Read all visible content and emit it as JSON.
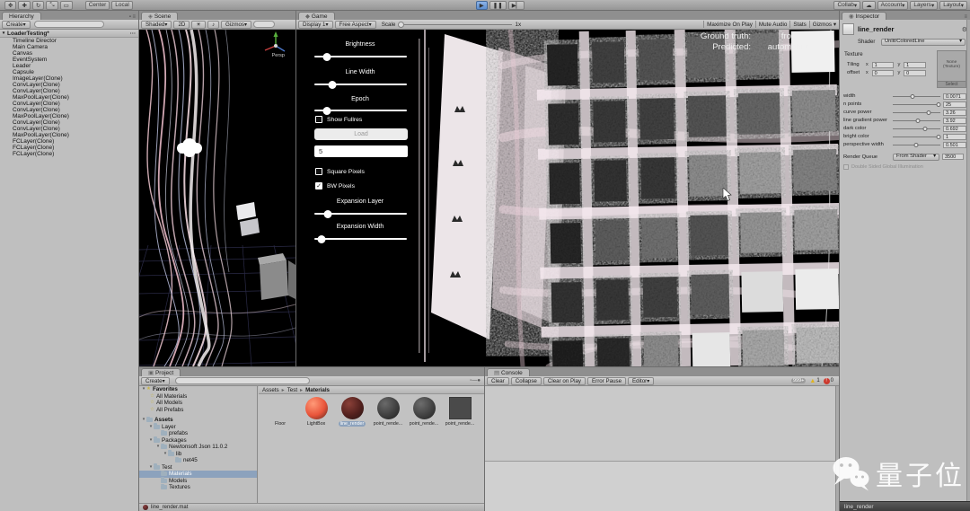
{
  "topbar": {
    "pivot": "Center",
    "space": "Local",
    "collab": "Collab",
    "account": "Account",
    "layers": "Layers",
    "layout": "Layout"
  },
  "hierarchy": {
    "tab": "Hierarchy",
    "create": "Create",
    "scene_name": "LoaderTesting*",
    "items": [
      "Timeline Director",
      "Main Camera",
      "Canvas",
      "EventSystem",
      "Leader",
      "Capsule",
      "ImageLayer(Clone)",
      "ConvLayer(Clone)",
      "ConvLayer(Clone)",
      "MaxPoolLayer(Clone)",
      "ConvLayer(Clone)",
      "ConvLayer(Clone)",
      "MaxPoolLayer(Clone)",
      "ConvLayer(Clone)",
      "ConvLayer(Clone)",
      "MaxPoolLayer(Clone)",
      "FCLayer(Clone)",
      "FCLayer(Clone)",
      "FCLayer(Clone)"
    ]
  },
  "scene": {
    "tab": "Scene",
    "shaded": "Shaded",
    "mode2d": "2D",
    "gizmos": "Gizmos",
    "persp": "Persp"
  },
  "game": {
    "tab": "Game",
    "display": "Display 1",
    "aspect": "Free Aspect",
    "scale_label": "Scale",
    "scale_value": "1x",
    "maximize": "Maximize On Play",
    "mute": "Mute Audio",
    "stats": "Stats",
    "gizmos": "Gizmos",
    "controls": {
      "brightness": "Brightness",
      "line_width": "Line Width",
      "epoch": "Epoch",
      "show_fullres": "Show Fullres",
      "load": "Load",
      "epoch_field": "5",
      "square_pixels": "Square Pixels",
      "bw_pixels": "BW Pixels",
      "expansion_layer": "Expansion Layer",
      "expansion_width": "Expansion Width",
      "slider_positions": {
        "brightness": "14%",
        "line_width": "19%",
        "epoch": "14%",
        "expansion_layer": "15%",
        "expansion_width": "8%"
      },
      "checkbox_states": {
        "show_fullres": false,
        "square_pixels": false,
        "bw_pixels": true
      }
    },
    "readout": {
      "gt_label": "Ground truth:",
      "gt_value": "frog",
      "pred_label": "Predicted:",
      "pred_value": "automobile"
    }
  },
  "inspector": {
    "tab": "Inspector",
    "material": "line_render",
    "shader_label": "Shader",
    "shader": "Unlit/ColoredLine",
    "texture_section": "Texture",
    "texture_slot": {
      "none": "None",
      "type": "(Texture)",
      "select": "Select"
    },
    "tiling_label": "Tiling",
    "offset_label": "offset",
    "x_label": "x",
    "y_label": "y",
    "tiling_x": "1",
    "tiling_y": "1",
    "offset_x": "0",
    "offset_y": "0",
    "props": [
      {
        "label": "width",
        "value": "0.0071",
        "pos": "42%"
      },
      {
        "label": "n points",
        "value": "25",
        "pos": "97%"
      },
      {
        "label": "curve power",
        "value": "3.26",
        "pos": "76%"
      },
      {
        "label": "line gradient power",
        "value": "3.92",
        "pos": "53%"
      },
      {
        "label": "dark color",
        "value": "0.692",
        "pos": "68%"
      },
      {
        "label": "bright color",
        "value": "1",
        "pos": "97%"
      },
      {
        "label": "perspective width",
        "value": "0.501",
        "pos": "49%"
      }
    ],
    "render_queue_label": "Render Queue",
    "render_queue_mode": "From Shader",
    "render_queue_value": "3500",
    "gi_label": "Double Sided Global Illumination",
    "preview_bar": "line_render"
  },
  "project": {
    "tab": "Project",
    "create": "Create",
    "breadcrumb": [
      "Assets",
      "Test",
      "Materials"
    ],
    "tree": [
      {
        "label": "Favorites"
      },
      {
        "label": "All Materials"
      },
      {
        "label": "All Models"
      },
      {
        "label": "All Prefabs"
      },
      {
        "label": "Assets"
      },
      {
        "label": "Layer"
      },
      {
        "label": "prefabs"
      },
      {
        "label": "Packages"
      },
      {
        "label": "Newtonsoft Json 11.0.2"
      },
      {
        "label": "lib"
      },
      {
        "label": "net45"
      },
      {
        "label": "Test"
      },
      {
        "label": "Materials"
      },
      {
        "label": "Models"
      },
      {
        "label": "Textures"
      }
    ],
    "assets": [
      {
        "name": "Floor",
        "color": "#2c2c2c",
        "hi": "#7d7d7d"
      },
      {
        "name": "LightBox",
        "color": "#e8543a",
        "hi": "#ff9a78"
      },
      {
        "name": "line_render",
        "color": "#52201d",
        "hi": "#8a4038"
      },
      {
        "name": "point_rende...",
        "color": "#3f3f3f",
        "hi": "#6a6a6a"
      },
      {
        "name": "point_rende...",
        "color": "#424242",
        "hi": "#6d6d6d"
      },
      {
        "name": "point_rende...",
        "color": "#4a4a4a",
        "hi": "#727272"
      }
    ],
    "footer": "line_render.mat"
  },
  "console": {
    "tab": "Console",
    "clear": "Clear",
    "collapse": "Collapse",
    "clear_on_play": "Clear on Play",
    "error_pause": "Error Pause",
    "editor": "Editor",
    "info_count": "999+",
    "warn_count": "1",
    "error_count": "0"
  },
  "watermark": {
    "text": "量子位"
  }
}
